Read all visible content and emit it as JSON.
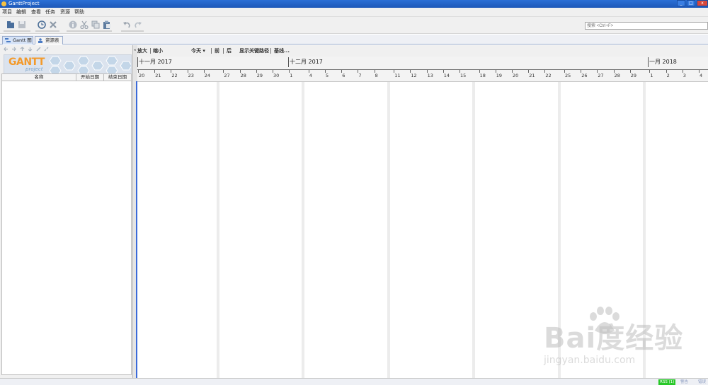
{
  "window": {
    "title": "GanttProject"
  },
  "menu": [
    "项目",
    "编辑",
    "查看",
    "任务",
    "资源",
    "帮助"
  ],
  "search": {
    "placeholder": "搜索 <Ctrl+F>"
  },
  "tabs": [
    {
      "label": "Gantt 图",
      "active": true
    },
    {
      "label": "资源表",
      "active": false
    }
  ],
  "logo": {
    "title": "GANTT",
    "subtitle": "project"
  },
  "task_table": {
    "columns": [
      "名称",
      "开始日期",
      "结束日期"
    ]
  },
  "chart_controls": {
    "zoom_in": "放大",
    "zoom_out": "缩小",
    "today": "今天 ▾",
    "prev": "前",
    "next": "后",
    "critical_path": "显示关键路径",
    "baseline": "基线..."
  },
  "timeline": {
    "months": [
      "十一月 2017",
      "十二月 2017",
      "一月 2018"
    ],
    "days": [
      "20",
      "21",
      "22",
      "23",
      "24",
      "27",
      "28",
      "29",
      "30",
      "1",
      "4",
      "5",
      "6",
      "7",
      "8",
      "11",
      "12",
      "13",
      "14",
      "15",
      "18",
      "19",
      "20",
      "21",
      "22",
      "25",
      "26",
      "27",
      "28",
      "29",
      "1",
      "2",
      "3",
      "4"
    ]
  },
  "status": {
    "rss": "RSS (1)",
    "item1": "警告",
    "item2": "错误"
  },
  "watermark": {
    "big": "Bai度经验",
    "small": "jingyan.baidu.com"
  },
  "colors": {
    "accent": "#3b6ad8",
    "titlebar": "#2b6fd6",
    "rss": "#28c828",
    "logo": "#f39a2b"
  }
}
